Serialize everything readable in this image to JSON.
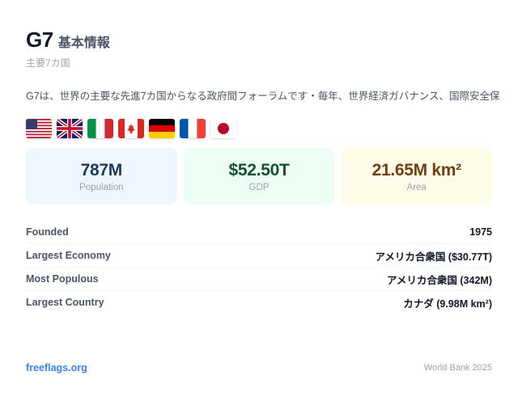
{
  "header": {
    "title": "G7",
    "title_suffix": "基本情報",
    "subtitle": "主要7カ国"
  },
  "description": "G7は、世界の主要な先進7カ国からなる政府間フォーラムです・毎年、世界経済ガバナンス、国際安全保",
  "flags": [
    {
      "name": "flag-usa-icon"
    },
    {
      "name": "flag-uk-icon"
    },
    {
      "name": "flag-italy-icon"
    },
    {
      "name": "flag-canada-icon"
    },
    {
      "name": "flag-germany-icon"
    },
    {
      "name": "flag-france-icon"
    },
    {
      "name": "flag-japan-icon"
    }
  ],
  "stats": {
    "population": {
      "value": "787M",
      "label": "Population",
      "color": "#eff6ff"
    },
    "gdp": {
      "value": "$52.50T",
      "label": "GDP",
      "color": "#ecfdf3"
    },
    "area": {
      "value": "21.65M km²",
      "label": "Area",
      "color": "#fefbe8"
    }
  },
  "facts": [
    {
      "label": "Founded",
      "value": "1975"
    },
    {
      "label": "Largest Economy",
      "value": "アメリカ合衆国 ($30.77T)"
    },
    {
      "label": "Most Populous",
      "value": "アメリカ合衆国 (342M)"
    },
    {
      "label": "Largest Country",
      "value": "カナダ (9.98M km²)"
    }
  ],
  "footer": {
    "link": "freeflags.org",
    "source": "World Bank 2025",
    "link_color": "#3b82f6"
  }
}
